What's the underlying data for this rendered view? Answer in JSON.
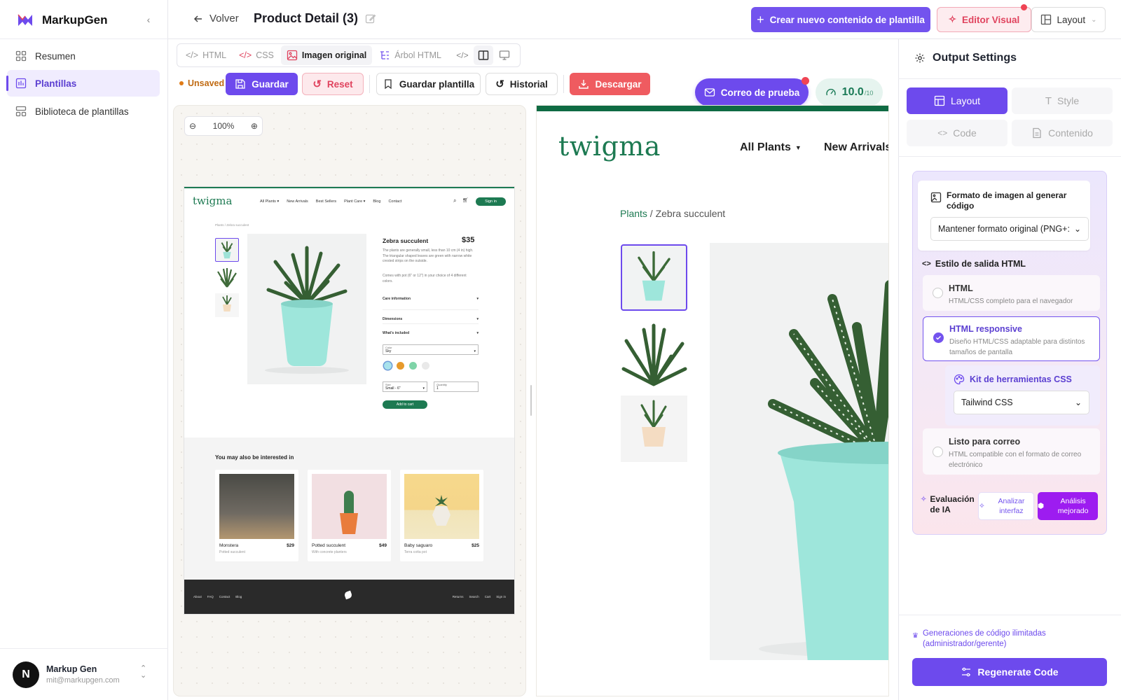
{
  "app": {
    "name": "MarkupGen"
  },
  "sidebar": {
    "items": [
      {
        "label": "Resumen"
      },
      {
        "label": "Plantillas"
      },
      {
        "label": "Biblioteca de plantillas"
      }
    ],
    "user": {
      "initial": "N",
      "name": "Markup Gen",
      "email": "mit@markupgen.com"
    }
  },
  "header": {
    "back_label": "Volver",
    "page_title": "Product Detail (3)",
    "create_button": "Crear nuevo contenido de plantilla",
    "visual_editor_button": "Editor Visual",
    "layout_button": "Layout"
  },
  "tabs": [
    {
      "label": "HTML"
    },
    {
      "label": "CSS"
    },
    {
      "label": "Imagen original"
    },
    {
      "label": "Árbol HTML"
    }
  ],
  "toolbar": {
    "status": "Unsaved",
    "save": "Guardar",
    "reset": "Reset",
    "save_template": "Guardar plantilla",
    "history": "Historial",
    "download": "Descargar",
    "test_email": "Correo de prueba",
    "score": "10.0",
    "score_max": "/10",
    "zoom": "100%"
  },
  "thumbnail": {
    "logo": "twigma",
    "nav": [
      "All Plants ▾",
      "New Arrivals",
      "Best Sellers",
      "Plant Care ▾",
      "Blog",
      "Contact"
    ],
    "signin": "Sign in",
    "breadcrumb": "Plants / Zebra succulent",
    "product_name": "Zebra succulent",
    "price": "$35",
    "desc1": "The plants are generally small, less than 10 cm (4 in) high. The triangular shaped leaves are green with narrow white crested strips on the outside.",
    "desc2": "Comes with pot (6\" or 12\") in your choice of 4 different colors.",
    "accordions": [
      "Care information",
      "Dimensions",
      "What's included"
    ],
    "color_label": "Color",
    "color_value": "Sky",
    "swatches": [
      "#a8e2ec",
      "#e79a2c",
      "#7fd4a8",
      "#e9e9e9"
    ],
    "size_label": "Size",
    "size_value": "Small - 6\"",
    "qty_label": "Quantity",
    "qty_value": "1",
    "add_to_cart": "Add to cart",
    "related_title": "You may also be interested in",
    "related": [
      {
        "name": "Monstera",
        "price": "$29",
        "sub": "Potted succulent"
      },
      {
        "name": "Potted succulent",
        "price": "$49",
        "sub": "With concrete planters"
      },
      {
        "name": "Baby saguaro",
        "price": "$25",
        "sub": "Terra cotta pot"
      }
    ],
    "footer_left": [
      "About",
      "FAQ",
      "Contact",
      "Blog"
    ],
    "footer_right": [
      "Returns",
      "Search",
      "Cart",
      "Sign in"
    ]
  },
  "preview": {
    "logo": "twigma",
    "nav": [
      "All Plants",
      "New Arrivals"
    ],
    "breadcrumb_link": "Plants",
    "breadcrumb_rest": " / Zebra succulent"
  },
  "settings": {
    "title": "Output Settings",
    "segments": [
      {
        "label": "Layout"
      },
      {
        "label": "Style"
      },
      {
        "label": "Code"
      },
      {
        "label": "Contenido"
      }
    ],
    "image_format_label": "Formato de imagen al generar código",
    "image_format_value": "Mantener formato original (PNG+:",
    "output_style_label": "Estilo de salida HTML",
    "options": [
      {
        "title": "HTML",
        "desc": "HTML/CSS completo para el navegador"
      },
      {
        "title": "HTML responsive",
        "desc": "Diseño HTML/CSS adaptable para distintos tamaños de pantalla"
      },
      {
        "title": "Listo para correo",
        "desc": "HTML compatible con el formato de correo electrónico"
      }
    ],
    "toolkit_label": "Kit de herramientas CSS",
    "toolkit_value": "Tailwind CSS",
    "ai_label": "Evaluación de IA",
    "ai_analyze": "Analizar interfaz",
    "ai_enhanced": "Análisis mejorado",
    "unlimited": "Generaciones de código ilimitadas (administrador/gerente)",
    "regenerate": "Regenerate Code"
  },
  "colors": {
    "accent": "#6d4aed",
    "brand_green": "#1d7a52",
    "danger": "#ef5b60"
  }
}
